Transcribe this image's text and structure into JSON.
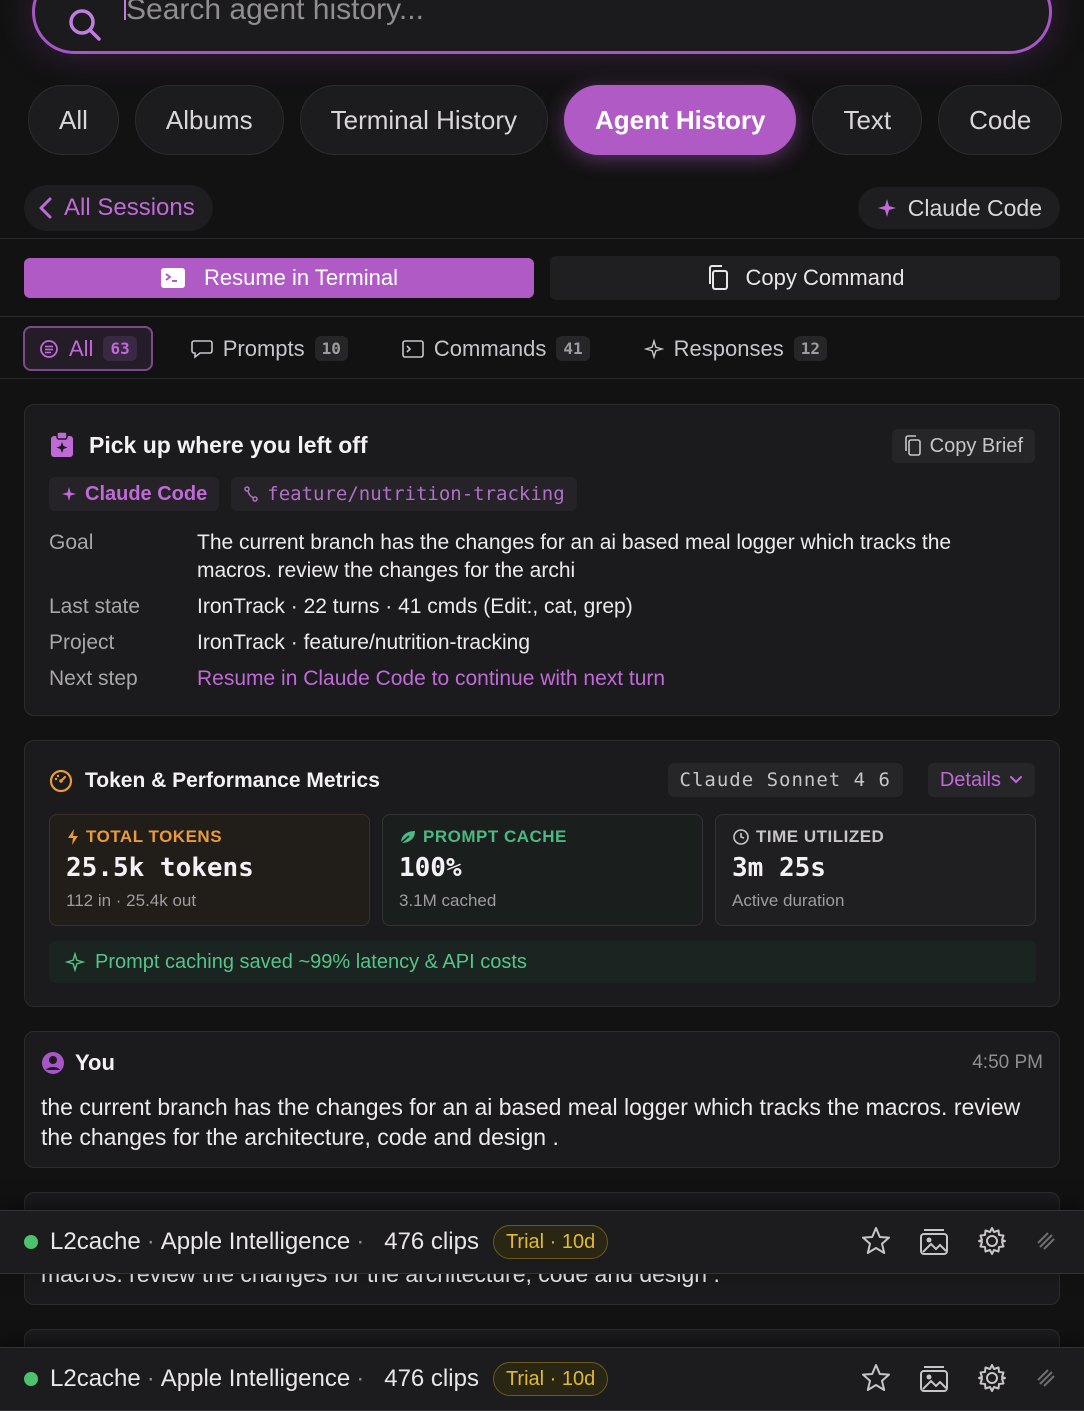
{
  "search": {
    "placeholder": "Search agent history..."
  },
  "categories": [
    "All",
    "Albums",
    "Terminal History",
    "Agent History",
    "Text",
    "Code"
  ],
  "session_bar": {
    "back_label": "All Sessions",
    "agent_label": "Claude Code"
  },
  "actions": {
    "resume_label": "Resume in Terminal",
    "copy_label": "Copy Command"
  },
  "filters": [
    {
      "label": "All",
      "count": "63"
    },
    {
      "label": "Prompts",
      "count": "10"
    },
    {
      "label": "Commands",
      "count": "41"
    },
    {
      "label": "Responses",
      "count": "12"
    }
  ],
  "brief": {
    "title": "Pick up where you left off",
    "copy_label": "Copy Brief",
    "agent_tag": "Claude Code",
    "branch_tag": "feature/nutrition-tracking",
    "rows": [
      {
        "key": "Goal",
        "value": "The current branch has the changes for an ai based meal logger which tracks the macros. review the changes for the archi"
      },
      {
        "key": "Last state",
        "value": "IronTrack · 22 turns · 41 cmds (Edit:, cat, grep)"
      },
      {
        "key": "Project",
        "value": "IronTrack · feature/nutrition-tracking"
      },
      {
        "key": "Next step",
        "value": "Resume in Claude Code to continue with next turn"
      }
    ]
  },
  "metrics": {
    "title": "Token & Performance Metrics",
    "model": "Claude Sonnet 4 6",
    "details_label": "Details",
    "boxes": [
      {
        "label": "TOTAL TOKENS",
        "value": "25.5k tokens",
        "sub": "112 in · 25.4k out",
        "color": "#e89a3c"
      },
      {
        "label": "PROMPT CACHE",
        "value": "100%",
        "sub": "3.1M cached",
        "color": "#4cb883"
      },
      {
        "label": "TIME UTILIZED",
        "value": "3m 25s",
        "sub": "Active duration",
        "color": "#c7c5ca"
      }
    ],
    "saved_note": "Prompt caching saved ~99% latency & API costs"
  },
  "message": {
    "author": "You",
    "time": "4:50 PM",
    "text": "the current branch has the changes for an ai based meal logger which tracks the macros. review the changes for the architecture, code and design .",
    "overlap_text": "macros. review the changes for the architecture, code and design ."
  },
  "status_bar": {
    "cache_name": "L2cache",
    "provider": "Apple Intelligence",
    "clips": "476 clips",
    "trial": "Trial · 10d"
  },
  "colors": {
    "accent": "#b05ac6",
    "background": "#121212",
    "card": "#1b1a1c",
    "success": "#4cc26e",
    "warning": "#e0b93a"
  }
}
